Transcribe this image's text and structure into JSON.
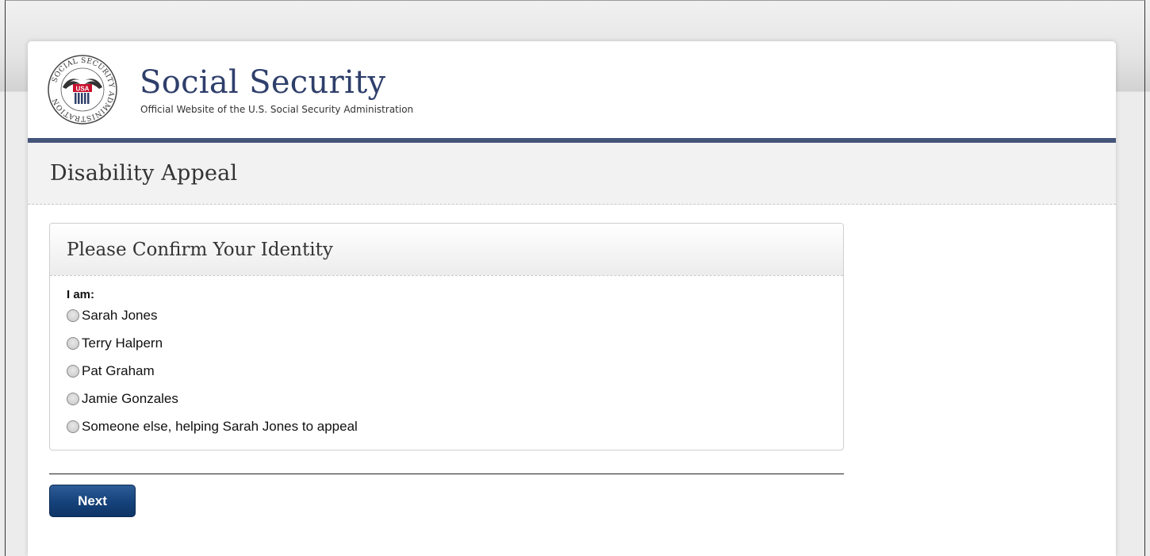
{
  "header": {
    "logo_icon": "ssa-seal-icon",
    "seal_text": "SOCIAL SECURITY ADMINISTRATION",
    "seal_badge": "USA",
    "title": "Social Security",
    "subtitle": "Official Website of the U.S. Social Security Administration",
    "accent_color": "#45557a"
  },
  "page": {
    "heading": "Disability Appeal"
  },
  "identity_panel": {
    "title": "Please Confirm Your Identity",
    "prompt": "I am:",
    "options": [
      {
        "label": "Sarah Jones",
        "selected": false
      },
      {
        "label": "Terry Halpern",
        "selected": false
      },
      {
        "label": "Pat Graham",
        "selected": false
      },
      {
        "label": "Jamie Gonzales",
        "selected": false
      },
      {
        "label": "Someone else, helping Sarah Jones to appeal",
        "selected": false
      }
    ]
  },
  "actions": {
    "next_label": "Next",
    "button_color": "#15427a"
  }
}
